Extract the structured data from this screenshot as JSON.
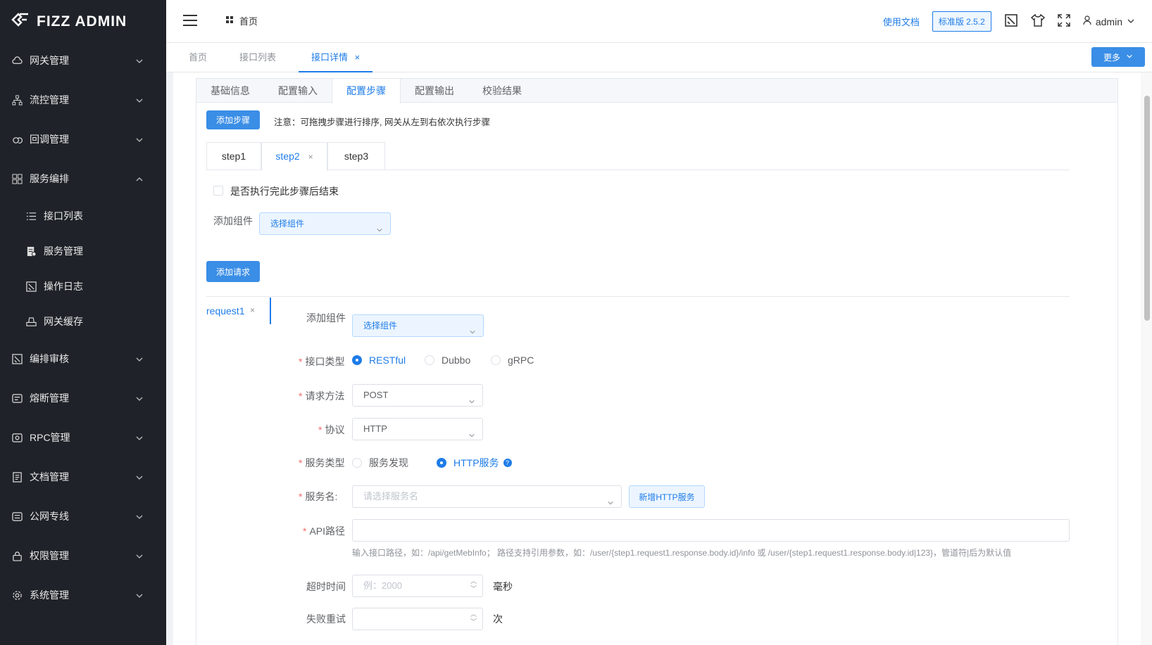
{
  "brand": {
    "logo_text": "FIZZ ADMIN"
  },
  "sidebar": {
    "items": [
      {
        "label": "网关管理",
        "icon": "cloud-icon"
      },
      {
        "label": "流控管理",
        "icon": "flow-icon"
      },
      {
        "label": "回调管理",
        "icon": "callback-icon"
      },
      {
        "label": "服务编排",
        "icon": "grid-icon"
      },
      {
        "label": "编排审核",
        "icon": "audit-icon"
      },
      {
        "label": "熔断管理",
        "icon": "breaker-icon"
      },
      {
        "label": "RPC管理",
        "icon": "rpc-icon"
      },
      {
        "label": "文档管理",
        "icon": "doc-icon"
      },
      {
        "label": "公网专线",
        "icon": "network-icon"
      },
      {
        "label": "权限管理",
        "icon": "lock-icon"
      },
      {
        "label": "系统管理",
        "icon": "gear-icon"
      }
    ],
    "sub_items": [
      {
        "label": "接口列表",
        "icon": "list-icon"
      },
      {
        "label": "服务管理",
        "icon": "service-icon"
      },
      {
        "label": "操作日志",
        "icon": "log-icon"
      },
      {
        "label": "网关缓存",
        "icon": "cache-icon"
      }
    ]
  },
  "header": {
    "breadcrumb": "首页",
    "doc_link": "使用文档",
    "version": "标准版 2.5.2",
    "user": "admin"
  },
  "tabs": {
    "items": [
      "首页",
      "接口列表",
      "接口详情"
    ],
    "active": "接口详情",
    "more": "更多"
  },
  "card_tabs": {
    "items": [
      "基础信息",
      "配置输入",
      "配置步骤",
      "配置输出",
      "校验结果"
    ],
    "active": "配置步骤"
  },
  "steps": {
    "add_button": "添加步骤",
    "note": "注意：可拖拽步骤进行排序, 网关从左到右依次执行步骤",
    "items": [
      "step1",
      "step2",
      "step3"
    ],
    "active": "step2",
    "end_checkbox_label": "是否执行完此步骤后结束",
    "add_component_label": "添加组件",
    "component_select": "选择组件",
    "add_request_button": "添加请求"
  },
  "request": {
    "tab_label": "request1",
    "add_component_label": "添加组件",
    "component_select": "选择组件",
    "api_type": {
      "label": "接口类型",
      "options": [
        "RESTful",
        "Dubbo",
        "gRPC"
      ],
      "selected": "RESTful"
    },
    "method": {
      "label": "请求方法",
      "value": "POST"
    },
    "protocol": {
      "label": "协议",
      "value": "HTTP"
    },
    "service_type": {
      "label": "服务类型",
      "options": [
        "服务发现",
        "HTTP服务"
      ],
      "selected": "HTTP服务"
    },
    "service_name": {
      "label": "服务名:",
      "placeholder": "请选择服务名",
      "add_button": "新增HTTP服务"
    },
    "api_path": {
      "label": "API路径",
      "value": "",
      "hint": "输入接口路径，如：/api/getMebInfo；  路径支持引用参数，如：/user/{step1.request1.response.body.id}/info 或 /user/{step1.request1.response.body.id|123}，管道符|后为默认值"
    },
    "timeout": {
      "label": "超时时间",
      "placeholder": "例：2000",
      "unit": "毫秒"
    },
    "retry": {
      "label": "失败重试",
      "unit": "次"
    }
  },
  "colors": {
    "sidebar_bg": "#1f2329",
    "primary": "#1e7ce8",
    "button": "#3a8ee6",
    "required": "#f56c6c"
  }
}
